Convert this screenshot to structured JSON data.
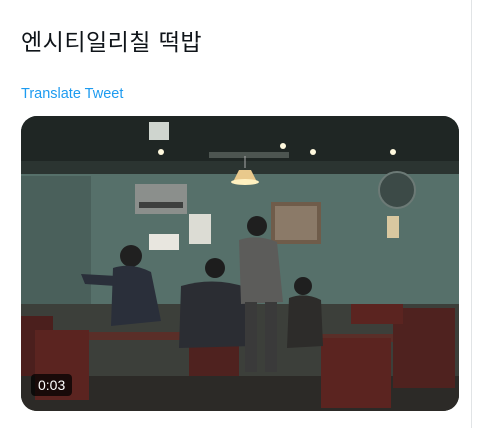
{
  "tweet": {
    "text": "엔시티일리칠 떡밥",
    "translate_label": "Translate Tweet"
  },
  "video": {
    "duration": "0:03"
  },
  "colors": {
    "link": "#1d9bf0",
    "text": "#0f1419"
  }
}
